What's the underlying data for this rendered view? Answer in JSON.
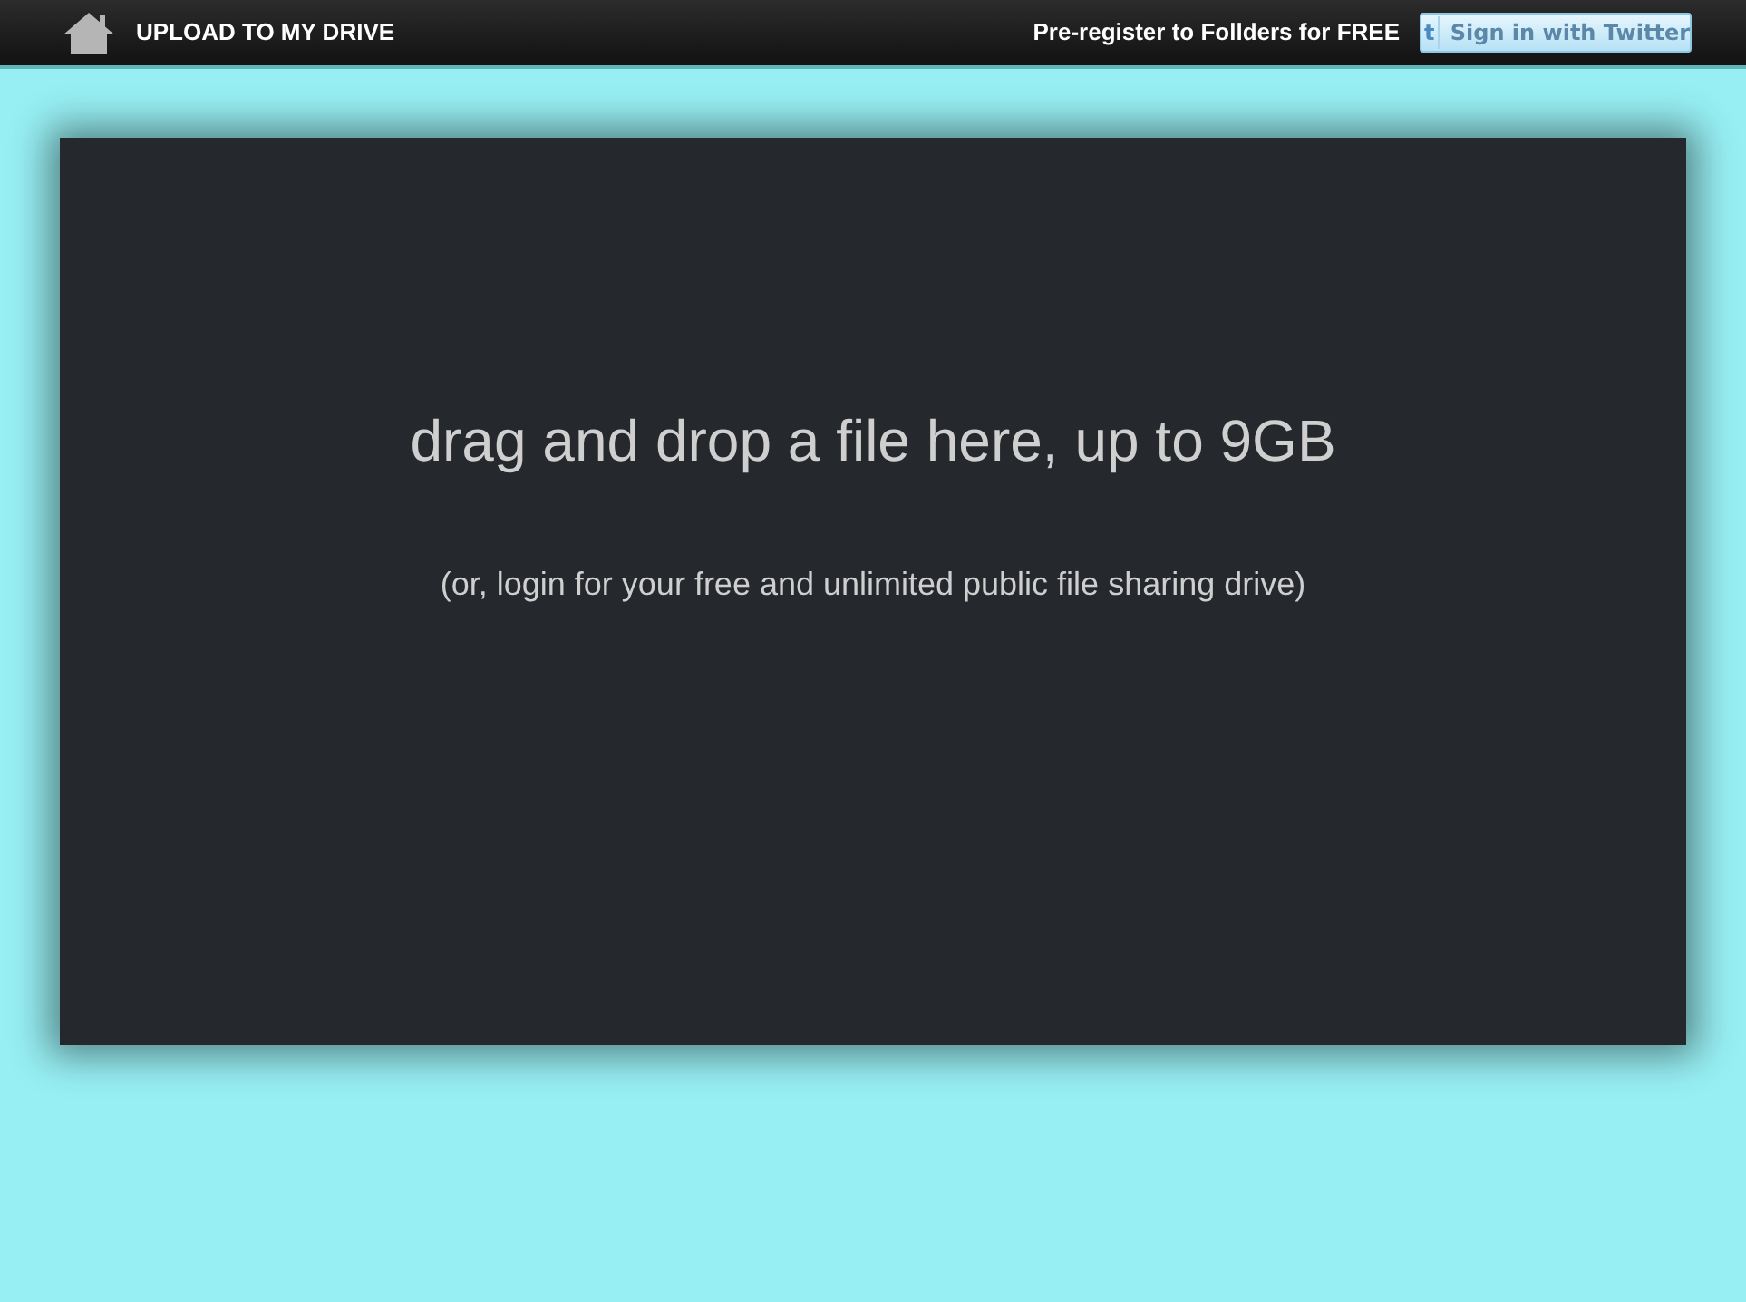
{
  "header": {
    "home_link": "UPLOAD TO MY DRIVE",
    "promo": "Pre-register to Follders for FREE",
    "twitter_button": {
      "icon": "t",
      "label": "Sign in with Twitter"
    }
  },
  "drop_zone": {
    "heading": "drag and drop a file here, up to 9GB",
    "subtext": "(or, login for your free and unlimited public file sharing drive)"
  }
}
